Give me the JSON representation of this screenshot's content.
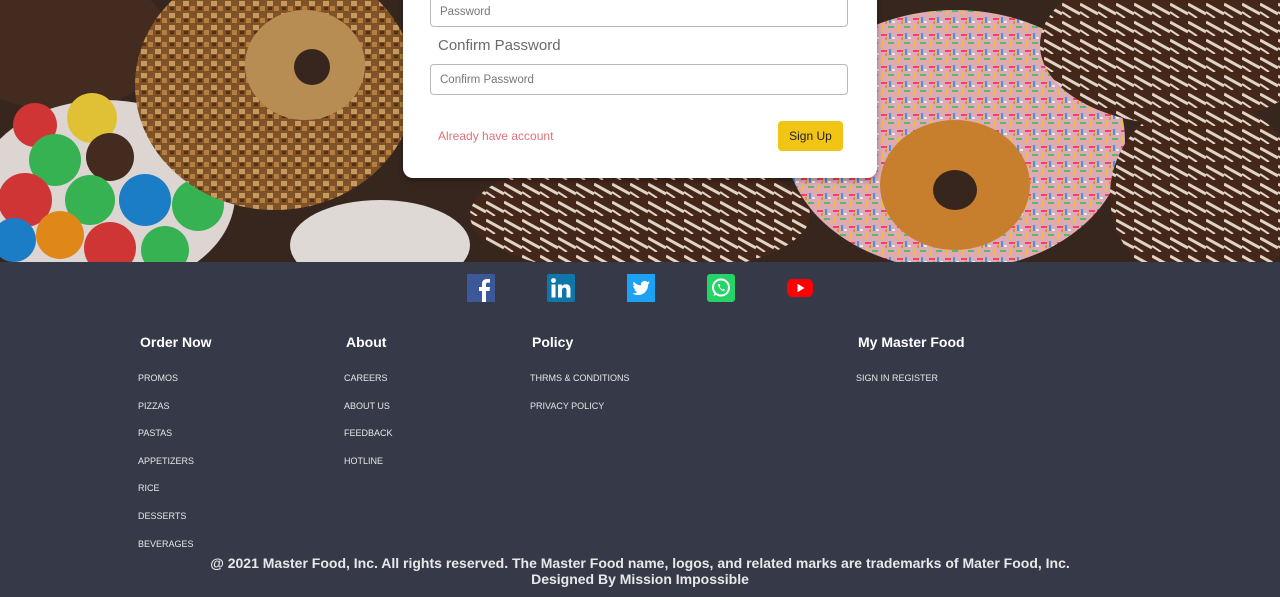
{
  "form": {
    "password_placeholder": "Password",
    "confirm_label": "Confirm Password",
    "confirm_placeholder": "Confirm Password",
    "login_link": "Already have account",
    "signup_label": "Sign Up",
    "colors": {
      "link": "#e0707a",
      "button": "#f2c413"
    }
  },
  "social": [
    {
      "icon": "facebook-icon",
      "color": "#3b5998"
    },
    {
      "icon": "linkedin-icon",
      "color": "#0e76a8"
    },
    {
      "icon": "twitter-icon",
      "color": "#1da1f2"
    },
    {
      "icon": "whatsapp-icon",
      "color": "#25d366"
    },
    {
      "icon": "youtube-icon",
      "color": "#ff0000"
    }
  ],
  "footer": {
    "columns": [
      {
        "title": "Order Now",
        "items": [
          "PROMOS",
          "PIZZAS",
          "PASTAS",
          "APPETIZERS",
          "RICE",
          "DESSERTS",
          "BEVERAGES"
        ]
      },
      {
        "title": "About",
        "items": [
          "CAREERS",
          "ABOUT US",
          "FEEDBACK",
          "HOTLINE"
        ]
      },
      {
        "title": "Policy",
        "items": [
          "THRMS & CONDITIONS",
          "PRIVACY POLICY"
        ]
      },
      {
        "title": "My Master Food",
        "items": [
          "SIGN IN REGISTER"
        ]
      }
    ],
    "copyright": "@ 2021 Master Food, Inc. All rights reserved. The Master Food name, logos, and related marks are trademarks of Mater Food, Inc.",
    "credit": "Designed By Mission Impossible",
    "background": "#363a48"
  }
}
